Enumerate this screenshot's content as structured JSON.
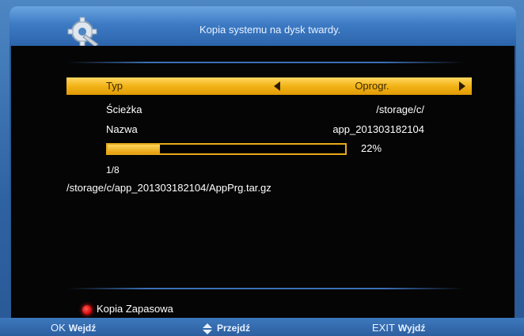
{
  "header": {
    "title": "Kopia systemu na dysk twardy.",
    "icon": "gear-wrench-icon"
  },
  "menu": {
    "rows": [
      {
        "label": "Typ",
        "value": "Oprogr.",
        "selected": true
      },
      {
        "label": "Ścieżka",
        "value": "/storage/c/"
      },
      {
        "label": "Nazwa",
        "value": "app_201303182104"
      }
    ]
  },
  "progress": {
    "percent": 22,
    "percent_label": "22%",
    "counter": "1/8",
    "file_path": "/storage/c/app_201303182104/AppPrg.tar.gz"
  },
  "hint": {
    "color": "#e00000",
    "label": "Kopia Zapasowa"
  },
  "footer": {
    "ok_key": "OK",
    "ok_action": "Wejdź",
    "nav_action": "Przejdź",
    "exit_key": "EXIT",
    "exit_action": "Wyjdź"
  }
}
